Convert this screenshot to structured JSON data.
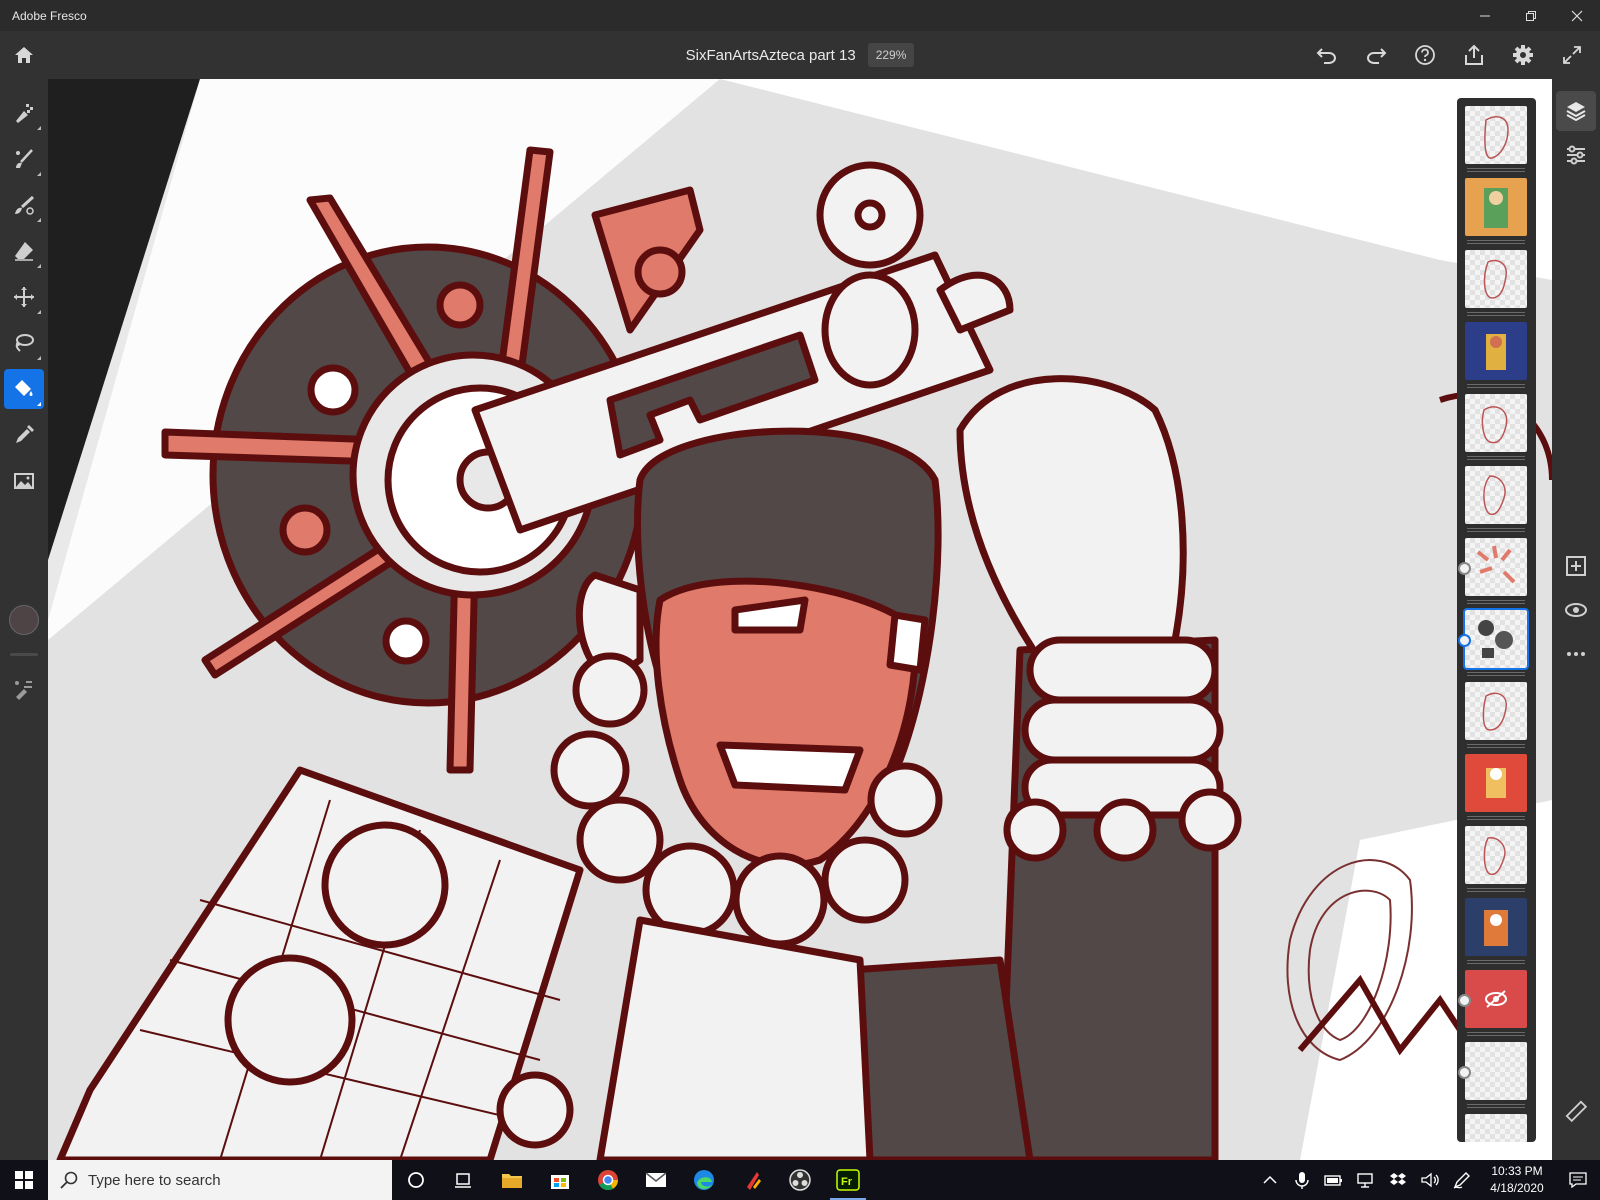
{
  "window": {
    "title": "Adobe Fresco",
    "controls": [
      "minimize",
      "restore",
      "close"
    ]
  },
  "header": {
    "document_name": "SixFanArtsAzteca part 13",
    "zoom": "229%",
    "icons": [
      "home-icon",
      "undo-icon",
      "redo-icon",
      "help-icon",
      "share-icon",
      "settings-icon",
      "fullscreen-icon"
    ]
  },
  "toolbar": {
    "tools": [
      "pixel-brush",
      "live-brush",
      "vector-brush",
      "eraser",
      "move-transform",
      "selection",
      "fill",
      "eyedropper",
      "place-image"
    ],
    "active_tool": "fill",
    "current_color": "#4e4446"
  },
  "layers": {
    "count_visible": 15,
    "selected_index": 7,
    "items": [
      {
        "kind": "sketch"
      },
      {
        "kind": "color-orange"
      },
      {
        "kind": "sketch"
      },
      {
        "kind": "color-blue"
      },
      {
        "kind": "sketch"
      },
      {
        "kind": "sketch"
      },
      {
        "kind": "red-splash"
      },
      {
        "kind": "dark-shapes"
      },
      {
        "kind": "sketch"
      },
      {
        "kind": "color-red"
      },
      {
        "kind": "sketch"
      },
      {
        "kind": "color-mixed"
      },
      {
        "kind": "hidden-red"
      },
      {
        "kind": "blank"
      },
      {
        "kind": "blank"
      }
    ]
  },
  "right_panel": {
    "icons": [
      "layers-icon",
      "layer-properties-icon",
      "add-layer-icon",
      "visibility-icon",
      "more-icon",
      "ruler-icon"
    ]
  },
  "taskbar": {
    "search_placeholder": "Type here to search",
    "time": "10:33 PM",
    "date": "4/18/2020",
    "pinned": [
      "cortana-icon",
      "task-view-icon",
      "file-explorer-icon",
      "store-icon",
      "chrome-icon",
      "mail-icon",
      "edge-icon",
      "sketchable-icon",
      "obs-icon",
      "fresco-icon"
    ]
  },
  "colors": {
    "accent": "#1473e6",
    "art_line": "#5c0e0e",
    "art_skin": "#e07a6b",
    "art_dark": "#524848",
    "art_paper": "#e3e3e3"
  }
}
